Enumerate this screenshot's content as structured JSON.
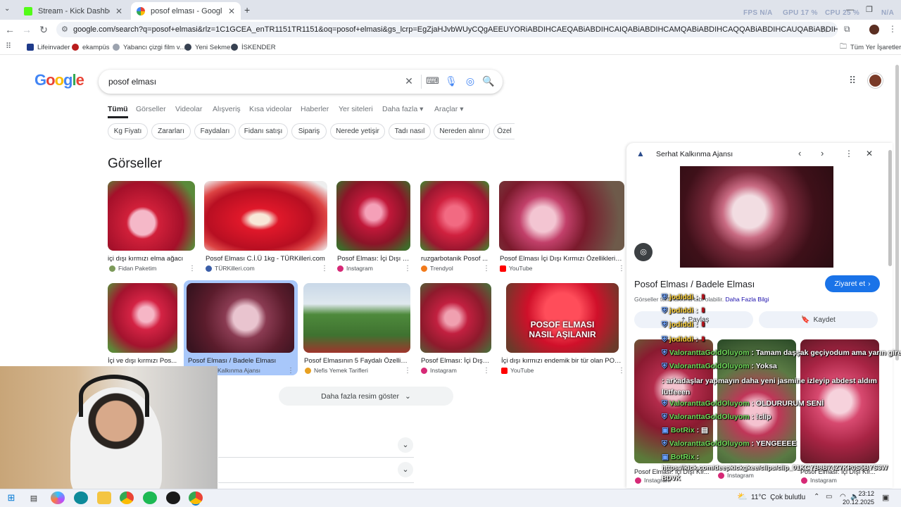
{
  "browser": {
    "tabs": [
      {
        "title": "Stream - Kick Dashboard",
        "active": false
      },
      {
        "title": "posof elması - Google'da Ara",
        "active": true
      }
    ],
    "url": "google.com/search?q=posof+elmasi&rlz=1C1GCEA_enTR1151TR1151&oq=posof+elmasi&gs_lcrp=EgZjaHJvbWUyCQgAEEUYORiABDIHCAEQABiABDIHCAIQABiABDIHCAMQABiABDIHCAQQABiABDIHCAUQABiABDIHCAYQABiABDIHCAcQABiABDIHCAgQA...",
    "bookmarks": [
      "Lifeinvader",
      "ekampüs",
      "Yabancı çizgi film v...",
      "Yeni Sekme",
      "İSKENDER"
    ],
    "all_bookmarks": "Tüm Yer İşaretleri",
    "overlay": {
      "fps": "FPS N/A",
      "gpu": "GPU 17 %",
      "cpu": "CPU 25 %",
      "n": "N/A"
    }
  },
  "google": {
    "logo": "Google",
    "query": "posof elması",
    "nav_tabs": [
      "Tümü",
      "Görseller",
      "Videolar",
      "Alışveriş",
      "Kısa videolar",
      "Haberler",
      "Yer siteleri",
      "Daha fazla",
      "Araçlar"
    ],
    "chips": [
      "Kg Fiyatı",
      "Zararları",
      "Faydaları",
      "Fidanı satışı",
      "Sipariş",
      "Nerede yetişir",
      "Tadı nasıl",
      "Nereden alınır",
      "Özel"
    ],
    "section_title": "Görseller",
    "images": [
      {
        "caption": "içi dışı kırmızı elma ağacı",
        "source": "Fidan Paketim"
      },
      {
        "caption": "Posof Elması C.İ.Ü 1kg - TÜRKilleri.com",
        "source": "TÜRKilleri.com"
      },
      {
        "caption": "Posof Elması: İçi Dışı K...",
        "source": "Instagram"
      },
      {
        "caption": "ruzgarbotanik Posof ...",
        "source": "Trendyol"
      },
      {
        "caption": "Posof Elması İçi Dışı Kırmızı Özellikleri F...",
        "source": "YouTube"
      },
      {
        "caption": "İçi ve dışı kırmızı Pos...",
        "source": ""
      },
      {
        "caption": "Posof Elması / Badele Elması",
        "source": "Kalkınma Ajansı"
      },
      {
        "caption": "Posof Elmasının 5 Faydalı Özelliği ...",
        "source": "Nefis Yemek Tarifleri"
      },
      {
        "caption": "Posof Elması: İçi Dışı ...",
        "source": "Instagram"
      },
      {
        "caption": "İçi dışı kırmızı endemik bir tür olan POS...",
        "source": "YouTube"
      }
    ],
    "thumb_overlay_text": "POSOF ELMASI NASIL AŞILANIR",
    "more_images": "Daha fazla resim göster"
  },
  "panel": {
    "source": "Serhat Kalkınma Ajansı",
    "title": "Posof Elması / Badele Elması",
    "visit": "Ziyaret et",
    "notice": "Görseller telif hakkına tabi olabilir.",
    "more_info": "Daha Fazla Bilgi",
    "share": "Paylaş",
    "save": "Kaydet",
    "related": [
      {
        "caption": "Posof Elması: İçi Dışı Kır...",
        "source": "Instagram"
      },
      {
        "caption": "",
        "source": "Instagram"
      },
      {
        "caption": "Posof Elması: İçi Dışı Kır...",
        "source": "Instagram"
      }
    ]
  },
  "chat": [
    {
      "user": "jodiddi",
      "msg": ""
    },
    {
      "user": "jodiddi",
      "msg": ""
    },
    {
      "user": "jodiddi",
      "msg": ""
    },
    {
      "user": "jodiddi",
      "msg": ""
    },
    {
      "user": "ValoranttaGoldOluyom",
      "msg": "Tamam daşşak geçiyodum ama yarın girecez"
    },
    {
      "user": "ValoranttaGoldOluyom",
      "msg": "Yoksa"
    },
    {
      "user": "",
      "msg": "arkadaşlar yapmayın daha yeni jasmine izleyip abdest aldım lütfeeen"
    },
    {
      "user": "ValoranttaGoldOluyom",
      "msg": "OLDURURUM SENİ"
    },
    {
      "user": "ValoranttaGoldOluyom",
      "msg": "!clip"
    },
    {
      "user": "BotRix",
      "msg": ""
    },
    {
      "user": "ValoranttaGoldOluyom",
      "msg": "YENGEEEE"
    },
    {
      "user": "BotRix",
      "msg": ""
    }
  ],
  "chat_link": "https://kick.com/deepkickgkee/clips/clip_01KCYB8B74Z7KP0S5BYS3W",
  "chat_tail": "BDVK",
  "taskbar": {
    "weather": "11°C  Çok bulutlu",
    "time": "23:12",
    "date": "20.12.2025"
  },
  "colors": {
    "google_blue": "#1a73e8",
    "selected": "#a8c7fa",
    "chrome_bg": "#dfe3eb"
  }
}
